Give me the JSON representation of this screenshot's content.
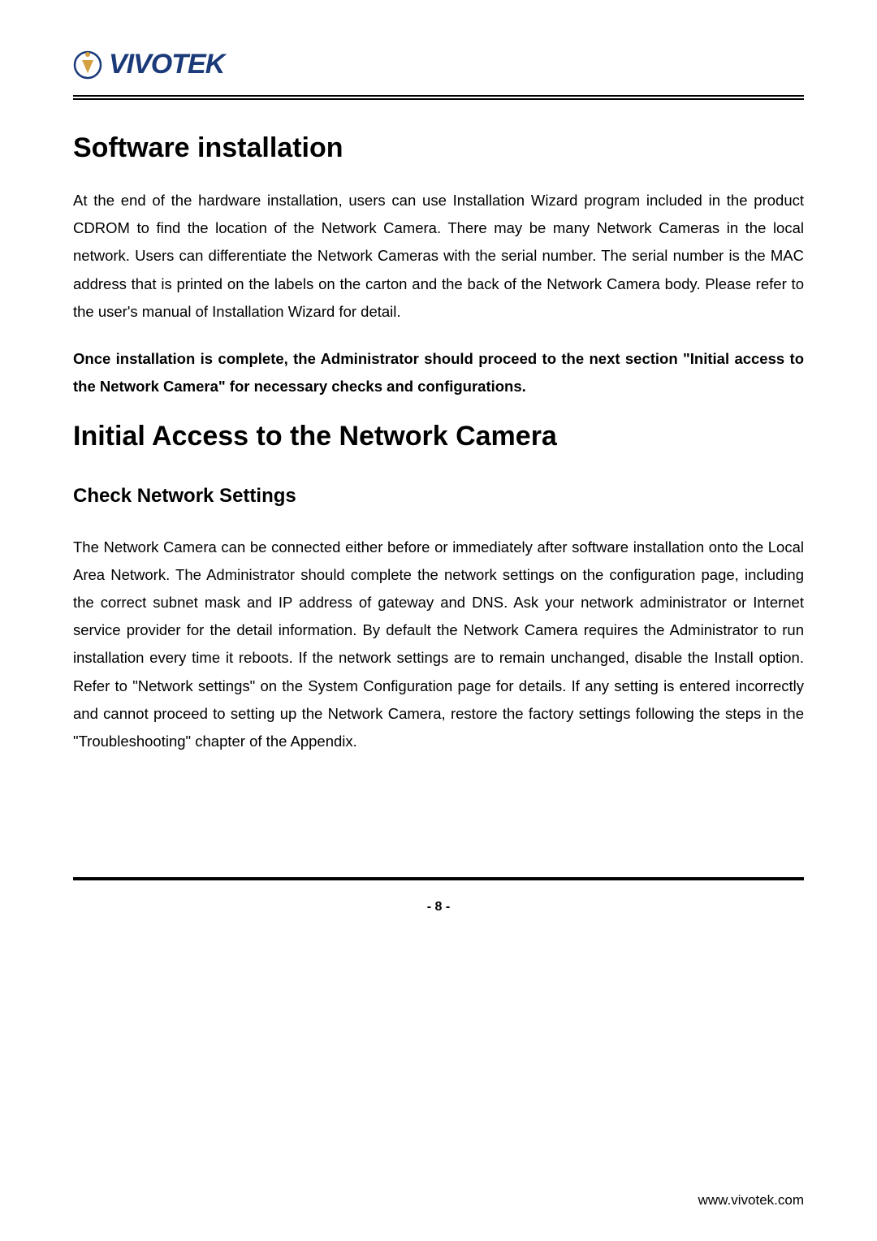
{
  "logo": {
    "brand": "VIVOTEK"
  },
  "sections": {
    "h1a": "Software installation",
    "p1": "At the end of the hardware installation, users can use Installation Wizard program included in the product CDROM to find the location of the Network Camera. There may be many Network Cameras in the local network. Users can differentiate the Network Cameras with the serial number. The serial number is the MAC address that is printed on the labels on the carton and the back of the Network Camera body. Please refer to the user's manual of Installation Wizard for detail.",
    "p2": "Once installation is complete, the Administrator should proceed to the next section \"Initial access to the Network Camera\" for necessary checks and configurations.",
    "h1b": "Initial Access to the Network Camera",
    "h2a": "Check Network Settings",
    "p3": "The Network Camera can be connected either before or immediately after software installation onto the Local Area Network. The Administrator should complete the network settings on the configuration page, including the correct subnet mask and IP address of gateway and DNS. Ask your network administrator or Internet service provider for the detail information. By default the Network Camera requires the Administrator to run installation every time it reboots. If the network settings are to remain unchanged, disable the Install option. Refer to \"Network settings\" on the System Configuration page for details. If any setting is entered incorrectly and cannot proceed to setting up the Network Camera, restore the factory settings following the steps in the \"Troubleshooting\" chapter of the Appendix."
  },
  "footer": {
    "page_num": "- 8 -",
    "url": "www.vivotek.com"
  }
}
